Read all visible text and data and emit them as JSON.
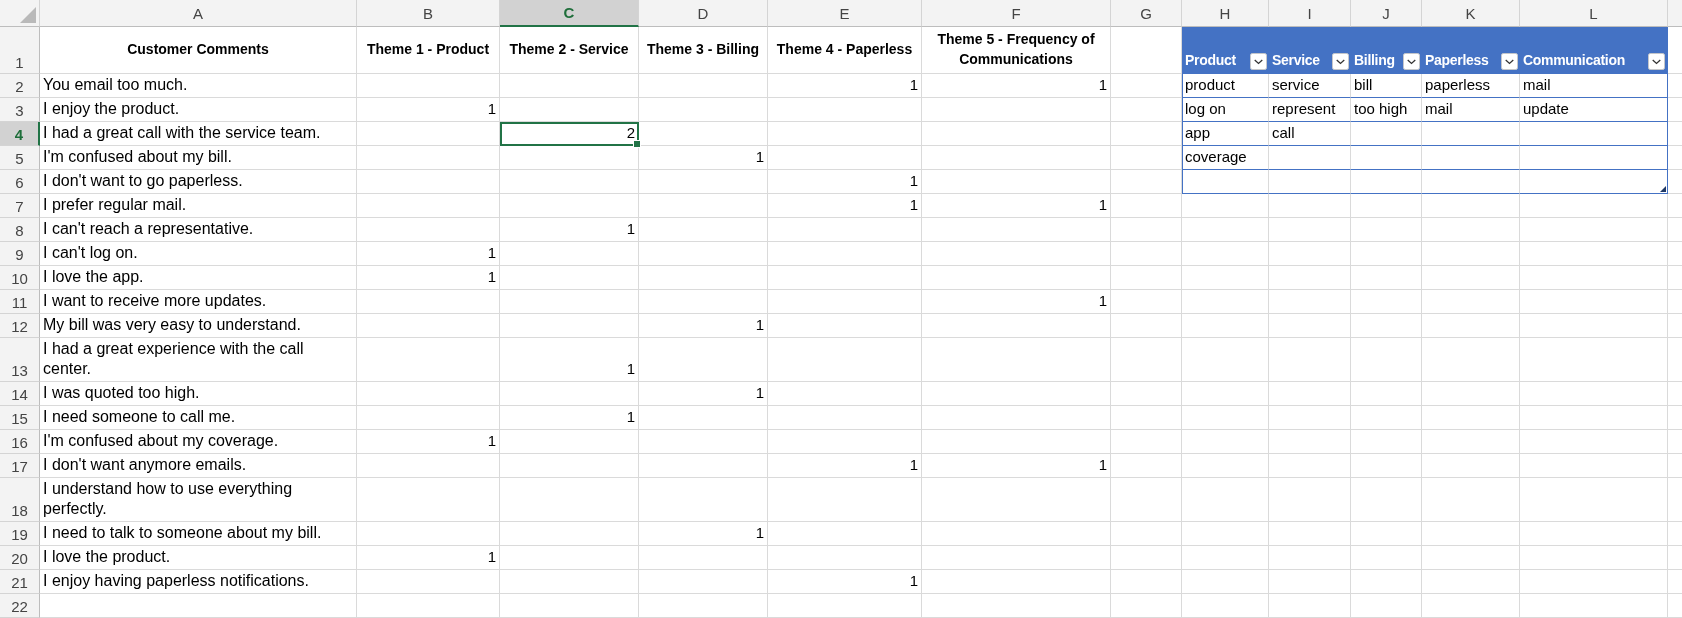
{
  "column_headers": [
    {
      "label": "A",
      "selected": false
    },
    {
      "label": "B",
      "selected": false
    },
    {
      "label": "C",
      "selected": true
    },
    {
      "label": "D",
      "selected": false
    },
    {
      "label": "E",
      "selected": false
    },
    {
      "label": "F",
      "selected": false
    },
    {
      "label": "G",
      "selected": false
    },
    {
      "label": "H",
      "selected": false
    },
    {
      "label": "I",
      "selected": false
    },
    {
      "label": "J",
      "selected": false
    },
    {
      "label": "K",
      "selected": false
    },
    {
      "label": "L",
      "selected": false
    }
  ],
  "rows": [
    {
      "label": "1",
      "selected": false,
      "kind": "header",
      "headings": [
        "Customer Comments",
        "Theme 1 - Product",
        "Theme 2 - Service",
        "Theme 3 - Billing",
        "Theme 4 - Paperless",
        "Theme 5 - Frequency of Communications"
      ]
    },
    {
      "label": "2",
      "selected": false,
      "kind": "data",
      "comment": "You email too much.",
      "counts": [
        {
          "selected": false
        },
        {
          "selected": false
        },
        {
          "selected": false
        },
        {
          "value": "1",
          "selected": false
        },
        {
          "value": "1",
          "selected": false
        }
      ]
    },
    {
      "label": "3",
      "selected": false,
      "kind": "data",
      "comment": "I enjoy the product.",
      "counts": [
        {
          "value": "1",
          "selected": false
        },
        {
          "selected": false
        },
        {
          "selected": false
        },
        {
          "selected": false
        },
        {
          "selected": false
        }
      ]
    },
    {
      "label": "4",
      "selected": true,
      "kind": "data",
      "comment": "I had a great call with the service team.",
      "counts": [
        {
          "selected": false
        },
        {
          "value": "2",
          "selected": true
        },
        {
          "selected": false
        },
        {
          "selected": false
        },
        {
          "selected": false
        }
      ]
    },
    {
      "label": "5",
      "selected": false,
      "kind": "data",
      "comment": "I'm confused about my bill.",
      "counts": [
        {
          "selected": false
        },
        {
          "selected": false
        },
        {
          "value": "1",
          "selected": false
        },
        {
          "selected": false
        },
        {
          "selected": false
        }
      ]
    },
    {
      "label": "6",
      "selected": false,
      "kind": "data",
      "comment": "I don't want to go paperless.",
      "counts": [
        {
          "selected": false
        },
        {
          "selected": false
        },
        {
          "selected": false
        },
        {
          "value": "1",
          "selected": false
        },
        {
          "selected": false
        }
      ]
    },
    {
      "label": "7",
      "selected": false,
      "kind": "data",
      "comment": "I prefer regular mail.",
      "counts": [
        {
          "selected": false
        },
        {
          "selected": false
        },
        {
          "selected": false
        },
        {
          "value": "1",
          "selected": false
        },
        {
          "value": "1",
          "selected": false
        }
      ]
    },
    {
      "label": "8",
      "selected": false,
      "kind": "data",
      "comment": "I can't reach a representative.",
      "counts": [
        {
          "selected": false
        },
        {
          "value": "1",
          "selected": false
        },
        {
          "selected": false
        },
        {
          "selected": false
        },
        {
          "selected": false
        }
      ]
    },
    {
      "label": "9",
      "selected": false,
      "kind": "data",
      "comment": "I can't log on.",
      "counts": [
        {
          "value": "1",
          "selected": false
        },
        {
          "selected": false
        },
        {
          "selected": false
        },
        {
          "selected": false
        },
        {
          "selected": false
        }
      ]
    },
    {
      "label": "10",
      "selected": false,
      "kind": "data",
      "comment": "I love the app.",
      "counts": [
        {
          "value": "1",
          "selected": false
        },
        {
          "selected": false
        },
        {
          "selected": false
        },
        {
          "selected": false
        },
        {
          "selected": false
        }
      ]
    },
    {
      "label": "11",
      "selected": false,
      "kind": "data",
      "comment": "I want to receive more updates.",
      "counts": [
        {
          "selected": false
        },
        {
          "selected": false
        },
        {
          "selected": false
        },
        {
          "selected": false
        },
        {
          "value": "1",
          "selected": false
        }
      ]
    },
    {
      "label": "12",
      "selected": false,
      "kind": "data",
      "comment": "My bill was very easy to understand.",
      "counts": [
        {
          "selected": false
        },
        {
          "selected": false
        },
        {
          "value": "1",
          "selected": false
        },
        {
          "selected": false
        },
        {
          "selected": false
        }
      ]
    },
    {
      "label": "13",
      "selected": false,
      "kind": "data",
      "comment": "I had a great experience with the call center.",
      "counts": [
        {
          "selected": false
        },
        {
          "value": "1",
          "selected": false
        },
        {
          "selected": false
        },
        {
          "selected": false
        },
        {
          "selected": false
        }
      ]
    },
    {
      "label": "14",
      "selected": false,
      "kind": "data",
      "comment": "I was quoted too high.",
      "counts": [
        {
          "selected": false
        },
        {
          "selected": false
        },
        {
          "value": "1",
          "selected": false
        },
        {
          "selected": false
        },
        {
          "selected": false
        }
      ]
    },
    {
      "label": "15",
      "selected": false,
      "kind": "data",
      "comment": "I need someone to call me.",
      "counts": [
        {
          "selected": false
        },
        {
          "value": "1",
          "selected": false
        },
        {
          "selected": false
        },
        {
          "selected": false
        },
        {
          "selected": false
        }
      ]
    },
    {
      "label": "16",
      "selected": false,
      "kind": "data",
      "comment": "I'm confused about my coverage.",
      "counts": [
        {
          "value": "1",
          "selected": false
        },
        {
          "selected": false
        },
        {
          "selected": false
        },
        {
          "selected": false
        },
        {
          "selected": false
        }
      ]
    },
    {
      "label": "17",
      "selected": false,
      "kind": "data",
      "comment": "I don't want anymore emails.",
      "counts": [
        {
          "selected": false
        },
        {
          "selected": false
        },
        {
          "selected": false
        },
        {
          "value": "1",
          "selected": false
        },
        {
          "value": "1",
          "selected": false
        }
      ]
    },
    {
      "label": "18",
      "selected": false,
      "kind": "data",
      "comment": "I understand how to use everything perfectly.",
      "counts": [
        {
          "selected": false
        },
        {
          "selected": false
        },
        {
          "selected": false
        },
        {
          "selected": false
        },
        {
          "selected": false
        }
      ]
    },
    {
      "label": "19",
      "selected": false,
      "kind": "data",
      "comment": "I need to talk to someone about my bill.",
      "counts": [
        {
          "selected": false
        },
        {
          "selected": false
        },
        {
          "value": "1",
          "selected": false
        },
        {
          "selected": false
        },
        {
          "selected": false
        }
      ]
    },
    {
      "label": "20",
      "selected": false,
      "kind": "data",
      "comment": "I love the product.",
      "counts": [
        {
          "value": "1",
          "selected": false
        },
        {
          "selected": false
        },
        {
          "selected": false
        },
        {
          "selected": false
        },
        {
          "selected": false
        }
      ]
    },
    {
      "label": "21",
      "selected": false,
      "kind": "data",
      "comment": "I enjoy having paperless notifications.",
      "counts": [
        {
          "selected": false
        },
        {
          "selected": false
        },
        {
          "selected": false
        },
        {
          "value": "1",
          "selected": false
        },
        {
          "selected": false
        }
      ]
    },
    {
      "label": "22",
      "selected": false,
      "kind": "data"
    }
  ],
  "lookup_table": {
    "columns": [
      {
        "header": "Product",
        "words": [
          "product",
          "log on",
          "app",
          "coverage"
        ]
      },
      {
        "header": "Service",
        "words": [
          "service",
          "represent",
          "call"
        ]
      },
      {
        "header": "Billing",
        "words": [
          "bill",
          "too high"
        ]
      },
      {
        "header": "Paperless",
        "words": [
          "paperless",
          "mail"
        ]
      },
      {
        "header": "Communication",
        "words": [
          "mail",
          "update"
        ]
      }
    ]
  }
}
